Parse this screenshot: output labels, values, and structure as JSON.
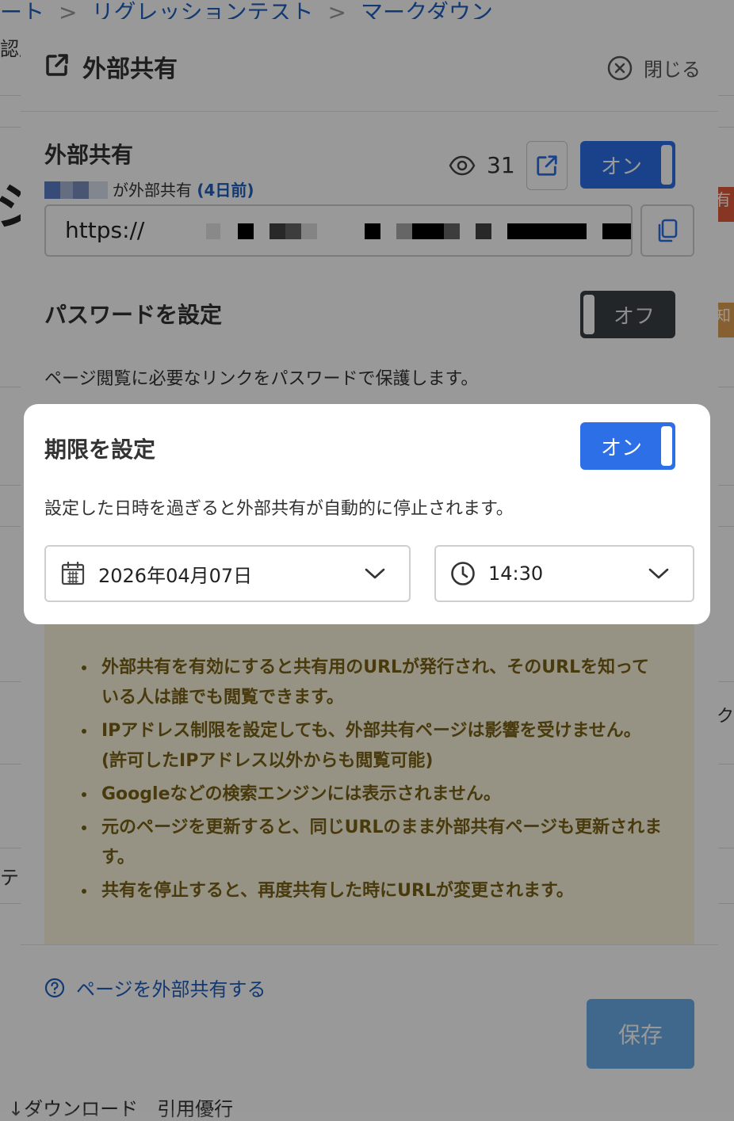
{
  "background": {
    "breadcrumb": [
      "ート",
      "リグレッションテスト",
      "マークダウン"
    ],
    "sub": "認尻",
    "big_text": "ジ活",
    "badges": [
      "有",
      "知"
    ],
    "footer": "↓ダウンロード　引用優行",
    "side_fragments": [
      "テ",
      "ク"
    ]
  },
  "modal": {
    "title": "外部共有",
    "close_label": "閉じる",
    "share": {
      "title": "外部共有",
      "shared_by_suffix": "が外部共有",
      "shared_when": "(4日前)",
      "view_count": "31",
      "toggle": "オン",
      "url_prefix": "https://"
    },
    "password": {
      "title": "パスワードを設定",
      "toggle": "オフ",
      "description": "ページ閲覧に必要なリンクをパスワードで保護します。"
    },
    "expiry": {
      "title": "期限を設定",
      "toggle": "オン",
      "description": "設定した日時を過ぎると外部共有が自動的に停止されます。",
      "date": "2026年04月07日",
      "time": "14:30"
    },
    "notices": [
      "外部共有を有効にすると共有用のURLが発行され、そのURLを知っている人は誰でも閲覧できます。",
      "IPアドレス制限を設定しても、外部共有ページは影響を受けません。(許可したIPアドレス以外からも閲覧可能)",
      "Googleなどの検索エンジンには表示されません。",
      "元のページを更新すると、同じURLのまま外部共有ページも更新されます。",
      "共有を停止すると、再度共有した時にURLが変更されます。"
    ],
    "help_link": "ページを外部共有する",
    "save_label": "保存"
  },
  "colors": {
    "accent": "#2c6fe6",
    "toggle_off": "#3b4045",
    "notice_bg": "#fbf6dc",
    "notice_text": "#7a6216",
    "save_button": "#6aaeea"
  }
}
